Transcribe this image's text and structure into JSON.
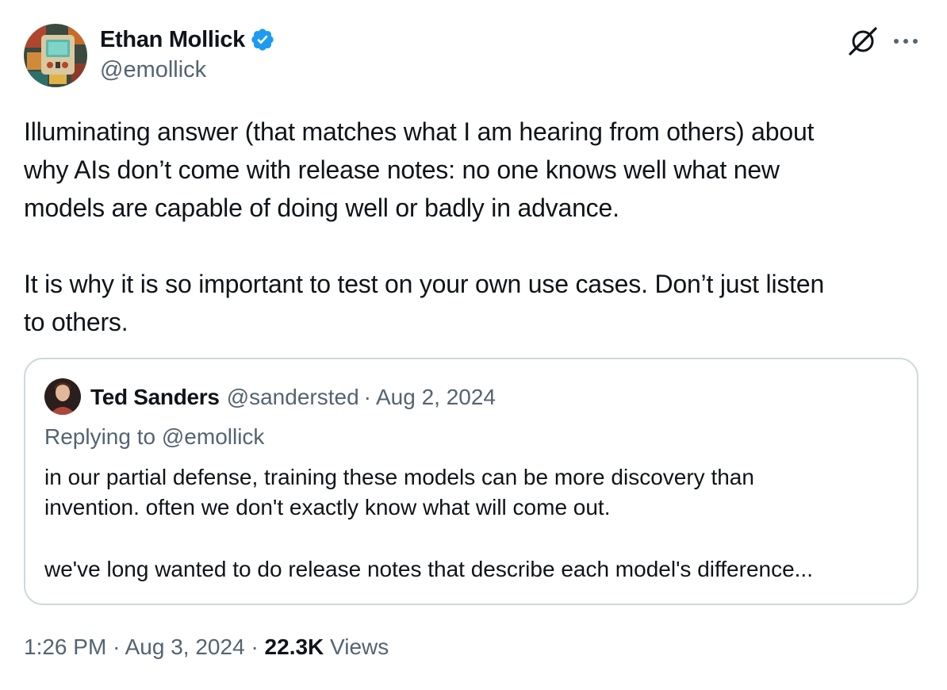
{
  "author": {
    "display_name": "Ethan Mollick",
    "handle": "@emollick",
    "verified": true
  },
  "actions": {
    "grok_icon": "grok-icon",
    "more_icon": "more-icon"
  },
  "tweet": {
    "paragraphs": [
      [
        "Illuminating answer (that matches what I am hearing from others) about",
        "why AIs don’t come with release notes: no one knows well what new",
        "models are capable of doing well or badly in advance."
      ],
      [
        "It is why it is so important to test on your own use cases. Don’t just listen",
        "to others."
      ]
    ]
  },
  "quoted_tweet": {
    "author_name": "Ted Sanders",
    "author_handle": "@sandersted",
    "separator": "·",
    "date": "Aug 2, 2024",
    "replying_label": "Replying to",
    "replying_handle": "@emollick",
    "paragraphs": [
      [
        "in our partial defense, training these models can be more discovery than",
        "invention. often we don't exactly know what will come out."
      ],
      [
        "we've long wanted to do release notes that describe each model's difference..."
      ]
    ]
  },
  "meta": {
    "time": "1:26 PM",
    "separator": "·",
    "date": "Aug 3, 2024",
    "views_count": "22.3K",
    "views_label": "Views"
  },
  "colors": {
    "text_primary": "#0f1419",
    "text_secondary": "#536471",
    "verified_blue": "#1d9bf0",
    "border": "#cfd9de"
  }
}
